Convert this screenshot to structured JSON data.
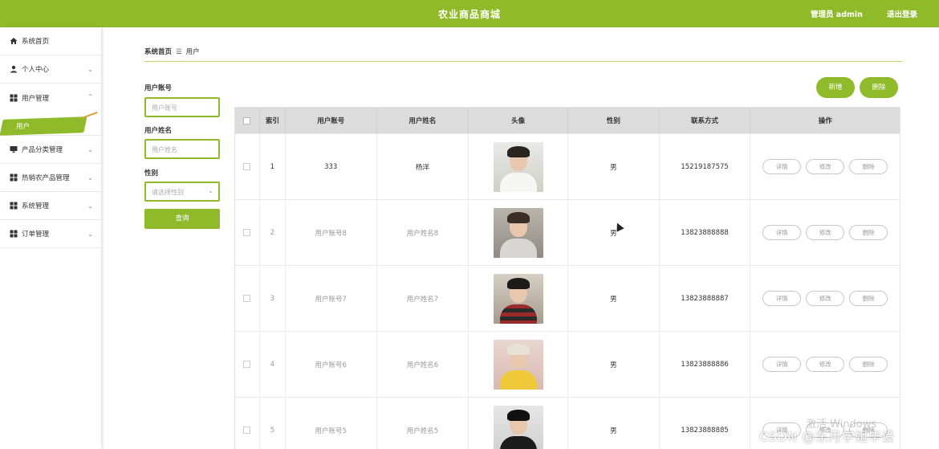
{
  "header": {
    "title": "农业商品商城",
    "admin": "管理员 admin",
    "logout": "退出登录"
  },
  "sidebar": {
    "items": [
      {
        "label": "系统首页",
        "icon": "home-icon"
      },
      {
        "label": "个人中心",
        "icon": "user-icon"
      },
      {
        "label": "用户管理",
        "icon": "grid-icon",
        "expanded": true,
        "children": [
          "用户"
        ]
      },
      {
        "label": "产品分类管理",
        "icon": "monitor-icon"
      },
      {
        "label": "热销农产品管理",
        "icon": "grid-icon"
      },
      {
        "label": "系统管理",
        "icon": "grid-icon"
      },
      {
        "label": "订单管理",
        "icon": "grid-icon"
      }
    ]
  },
  "breadcrumb": {
    "home": "系统首页",
    "separator": "☰",
    "current": "用户"
  },
  "search": {
    "account_label": "用户账号",
    "account_placeholder": "用户账号",
    "name_label": "用户姓名",
    "name_placeholder": "用户姓名",
    "gender_label": "性别",
    "gender_placeholder": "请选择性别",
    "query_button": "查询"
  },
  "actions": {
    "add": "新增",
    "delete": "删除"
  },
  "table": {
    "columns": [
      "索引",
      "用户账号",
      "用户姓名",
      "头像",
      "性别",
      "联系方式",
      "操作"
    ],
    "rows": [
      {
        "index": "1",
        "account": "333",
        "name": "杨洋",
        "gender": "男",
        "phone": "15219187575"
      },
      {
        "index": "2",
        "account": "用户账号8",
        "name": "用户姓名8",
        "gender": "男",
        "phone": "13823888888"
      },
      {
        "index": "3",
        "account": "用户账号7",
        "name": "用户姓名7",
        "gender": "男",
        "phone": "13823888887"
      },
      {
        "index": "4",
        "account": "用户账号6",
        "name": "用户姓名6",
        "gender": "男",
        "phone": "13823888886"
      },
      {
        "index": "5",
        "account": "用户账号5",
        "name": "用户姓名5",
        "gender": "男",
        "phone": "13823888885"
      }
    ],
    "row_actions": {
      "detail": "详情",
      "edit": "修改",
      "delete": "删除"
    }
  },
  "overlays": {
    "watermark": "CSDN @东月学姐毕设",
    "activate_windows": "激活 Windows"
  },
  "colors": {
    "accent": "#8fba2a"
  }
}
